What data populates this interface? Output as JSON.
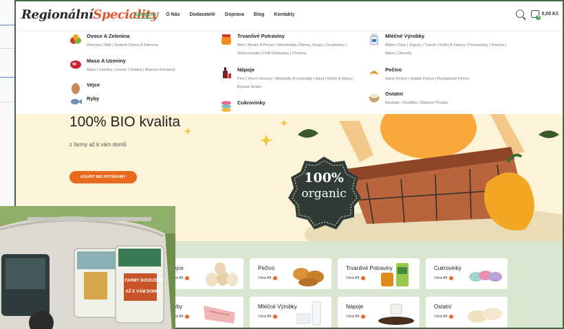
{
  "logo": {
    "part1": "Regionální",
    "part2": "Speciality"
  },
  "nav": [
    {
      "label": "Kategorie",
      "active": true
    },
    {
      "label": "O Nás",
      "active": false
    },
    {
      "label": "Dodavatelé",
      "active": false
    },
    {
      "label": "Doprava",
      "active": false
    },
    {
      "label": "Blog",
      "active": false
    },
    {
      "label": "Kontakty",
      "active": false
    }
  ],
  "cart": {
    "total": "0,00 Kč",
    "count": "0"
  },
  "menu": {
    "c1": {
      "title": "Ovoce A Zelenina",
      "subs": "Zelenina | Mák | Sušené Ovoce A Zelenina"
    },
    "c2": {
      "title": "Maso A Uzeniny",
      "subs": "Maso | Uzeniny | Uzené | Ostatní | Masové Konzervy"
    },
    "c3": {
      "title": "Vejce",
      "subs": ""
    },
    "c4": {
      "title": "Ryby",
      "subs": ""
    },
    "c5": {
      "title": "Trvanlivé Potraviny",
      "subs": "Med | Mouky A Pečení | Marmelády, Džemy, Sirupy | Zavařeniny | Ochucovadla | Chilli Delikatesy | Chutney"
    },
    "c6": {
      "title": "Nápoje",
      "subs": "Pivo | Víno | Lihoviny | Minerálky A Limonády | Káva | Mošty A Džusy | Bylinné Směsi"
    },
    "c7": {
      "title": "Cukrovinky",
      "subs": ""
    },
    "c8": {
      "title": "Mléčné Výrobky",
      "subs": "Mléko | Sýry | Jogurty | Tvaroh | Kefíry A Zákysy | Pomazánky | Smetna | Máslo | Dezerty"
    },
    "c9": {
      "title": "Pečivo",
      "subs": "Slané Pečivo | Sladké Pečivo | Bezlepkové Pečivo"
    },
    "c10": {
      "title": "Ostatní",
      "subs": "Ekologie | Knedlíky | Dárkový Poukaz"
    }
  },
  "hero": {
    "title": "100% BIO kvalita",
    "subtitle": "z farmy až k vám domů",
    "button": "KOUPIT BIO POTRAVINY",
    "badge_line1": "100%",
    "badge_line2": "organic"
  },
  "tiles": {
    "t1": "Vejce",
    "t2": "Pečivo",
    "t3": "Trvanlivé Potraviny",
    "t4": "Cukrovinky",
    "t5": "Ryby",
    "t6": "Mléčné Výrobky",
    "t7": "Nápoje",
    "t8": "Ostatní",
    "view_all": "View All"
  },
  "photo": {
    "sign1": "Z FARMY DOVEZEME",
    "sign2": "AŽ K VÁM DOMŮ"
  },
  "colors": {
    "accent": "#e96a1e",
    "green": "#3e9b52",
    "frame": "#3d6a43"
  }
}
